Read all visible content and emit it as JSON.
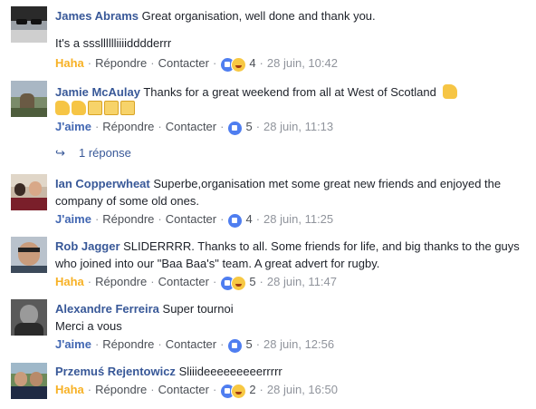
{
  "comments": [
    {
      "author": "James Abrams",
      "text": "Great organisation, well done and thank you.",
      "extra_line": "It's a ssslllllliiiidddderrr",
      "reaction_label": "Haha",
      "reaction_type": "haha",
      "reply_label": "Répondre",
      "contact_label": "Contacter",
      "reaction_icons": [
        "like-icon",
        "haha-icon"
      ],
      "reaction_count": "4",
      "timestamp": "28 juin, 10:42"
    },
    {
      "author": "Jamie McAulay",
      "text": "Thanks for a great weekend from all at West of Scotland",
      "emojis_inline": [
        "thumbs-up-emoji"
      ],
      "emojis_line2": [
        "thumbs-up-emoji",
        "thumbs-up-emoji",
        "beer-mugs-emoji",
        "beer-mugs-emoji",
        "beer-mugs-emoji"
      ],
      "reaction_label": "J'aime",
      "reaction_type": "like",
      "reply_label": "Répondre",
      "contact_label": "Contacter",
      "reaction_icons": [
        "like-icon"
      ],
      "reaction_count": "5",
      "timestamp": "28 juin, 11:13",
      "replies_label": "1 réponse"
    },
    {
      "author": "Ian Copperwheat",
      "text": "Superbe,organisation met some great new friends and enjoyed the company of some old ones.",
      "reaction_label": "J'aime",
      "reaction_type": "like",
      "reply_label": "Répondre",
      "contact_label": "Contacter",
      "reaction_icons": [
        "like-icon"
      ],
      "reaction_count": "4",
      "timestamp": "28 juin, 11:25"
    },
    {
      "author": "Rob Jagger",
      "text": "SLIDERRRR. Thanks to all. Some friends for life, and big thanks to the guys who joined into our \"Baa Baa's\" team. A great advert for rugby.",
      "reaction_label": "Haha",
      "reaction_type": "haha",
      "reply_label": "Répondre",
      "contact_label": "Contacter",
      "reaction_icons": [
        "like-icon",
        "haha-icon"
      ],
      "reaction_count": "5",
      "timestamp": "28 juin, 11:47"
    },
    {
      "author": "Alexandre Ferreira",
      "text": "Super tournoi",
      "extra_line": "Merci a vous",
      "reaction_label": "J'aime",
      "reaction_type": "like",
      "reply_label": "Répondre",
      "contact_label": "Contacter",
      "reaction_icons": [
        "like-icon"
      ],
      "reaction_count": "5",
      "timestamp": "28 juin, 12:56"
    },
    {
      "author": "Przemuś Rejentowicz",
      "text": "Sliiideeeeeeeeerrrrr",
      "reaction_label": "Haha",
      "reaction_type": "haha",
      "reply_label": "Répondre",
      "contact_label": "Contacter",
      "reaction_icons": [
        "like-icon",
        "haha-icon"
      ],
      "reaction_count": "2",
      "timestamp": "28 juin, 16:50"
    }
  ],
  "colors": {
    "author": "#385898",
    "haha": "#f7b125",
    "like": "#4267b2",
    "meta": "#90949c"
  }
}
